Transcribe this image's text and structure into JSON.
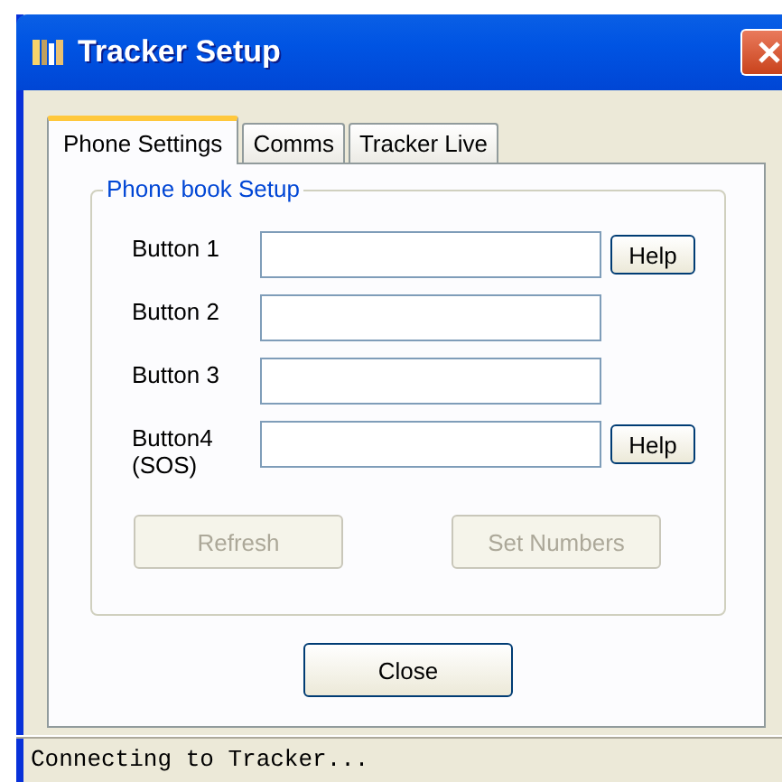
{
  "window": {
    "title": "Tracker Setup"
  },
  "tabs": [
    {
      "label": "Phone Settings",
      "selected": true
    },
    {
      "label": "Comms",
      "selected": false
    },
    {
      "label": "Tracker Live",
      "selected": false
    }
  ],
  "group": {
    "title": "Phone book Setup"
  },
  "fields": [
    {
      "label": "Button 1",
      "help": "Help"
    },
    {
      "label": "Button 2"
    },
    {
      "label": "Button 3"
    },
    {
      "label": "Button4\n(SOS)",
      "help": "Help"
    }
  ],
  "actions": [
    {
      "label": "Refresh",
      "disabled": true
    },
    {
      "label": "Set Numbers",
      "disabled": true
    }
  ],
  "close_button": {
    "label": "Close"
  },
  "status_bar": {
    "text": "Connecting to Tracker..."
  }
}
